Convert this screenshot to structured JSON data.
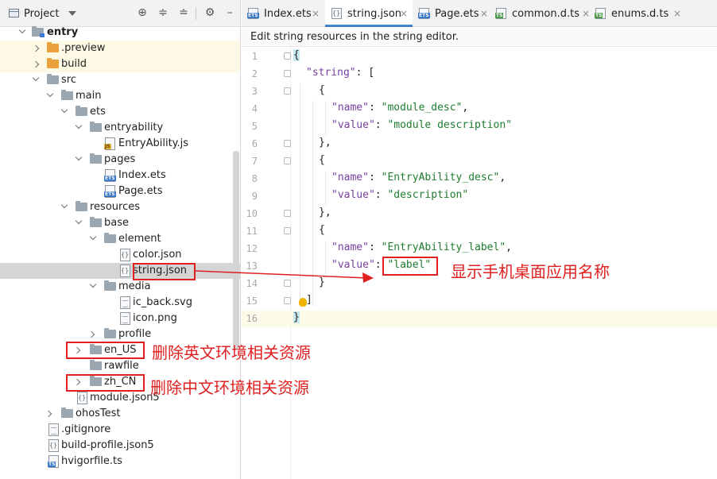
{
  "project_panel": {
    "title": "Project",
    "toolbar_icons": [
      "locate-icon",
      "expand-all-icon",
      "collapse-all-icon",
      "settings-icon",
      "hide-icon"
    ],
    "tree": [
      {
        "label": "entry",
        "bold": true
      },
      {
        "label": ".preview"
      },
      {
        "label": "build"
      },
      {
        "label": "src"
      },
      {
        "label": "main"
      },
      {
        "label": "ets"
      },
      {
        "label": "entryability"
      },
      {
        "label": "EntryAbility.js"
      },
      {
        "label": "pages"
      },
      {
        "label": "Index.ets"
      },
      {
        "label": "Page.ets"
      },
      {
        "label": "resources"
      },
      {
        "label": "base"
      },
      {
        "label": "element"
      },
      {
        "label": "color.json"
      },
      {
        "label": "string.json"
      },
      {
        "label": "media"
      },
      {
        "label": "ic_back.svg"
      },
      {
        "label": "icon.png"
      },
      {
        "label": "profile"
      },
      {
        "label": "en_US"
      },
      {
        "label": "rawfile"
      },
      {
        "label": "zh_CN"
      },
      {
        "label": "module.json5"
      },
      {
        "label": "ohosTest"
      },
      {
        "label": ".gitignore"
      },
      {
        "label": "build-profile.json5"
      },
      {
        "label": "hvigorfile.ts"
      }
    ]
  },
  "editor": {
    "tabs": [
      {
        "label": "Index.ets",
        "icon": "ets-file-icon"
      },
      {
        "label": "string.json",
        "icon": "json-file-icon",
        "active": true
      },
      {
        "label": "Page.ets",
        "icon": "ets-file-icon"
      },
      {
        "label": "common.d.ts",
        "icon": "ts-file-icon"
      },
      {
        "label": "enums.d.ts",
        "icon": "ts-file-icon"
      }
    ],
    "notice": "Edit string resources in the string editor.",
    "line_numbers": [
      "1",
      "2",
      "3",
      "4",
      "5",
      "6",
      "7",
      "8",
      "9",
      "10",
      "11",
      "12",
      "13",
      "14",
      "15",
      "16"
    ],
    "code": {
      "l1": "{",
      "l2_key": "\"string\"",
      "l2_rest": ": [",
      "l3": "{",
      "l4_key": "\"name\"",
      "l4_val": "\"module_desc\"",
      "l5_key": "\"value\"",
      "l5_val": "\"module description\"",
      "l6": "},",
      "l7": "{",
      "l8_key": "\"name\"",
      "l8_val": "\"EntryAbility_desc\"",
      "l9_key": "\"value\"",
      "l9_val": "\"description\"",
      "l10": "},",
      "l11": "{",
      "l12_key": "\"name\"",
      "l12_val": "\"EntryAbility_label\"",
      "l13_key": "\"value\"",
      "l13_val": "\"label\"",
      "l14": "}",
      "l15": "]",
      "l16": "}"
    }
  },
  "annotations": {
    "label_note": "显示手机桌面应用名称",
    "en_note": "删除英文环境相关资源",
    "zh_note": "删除中文环境相关资源"
  },
  "colors": {
    "annotation": "#e02020",
    "tab_active_underline": "#4083c9",
    "string_value": "#1e7d2f",
    "json_key": "#7a3fa0"
  }
}
